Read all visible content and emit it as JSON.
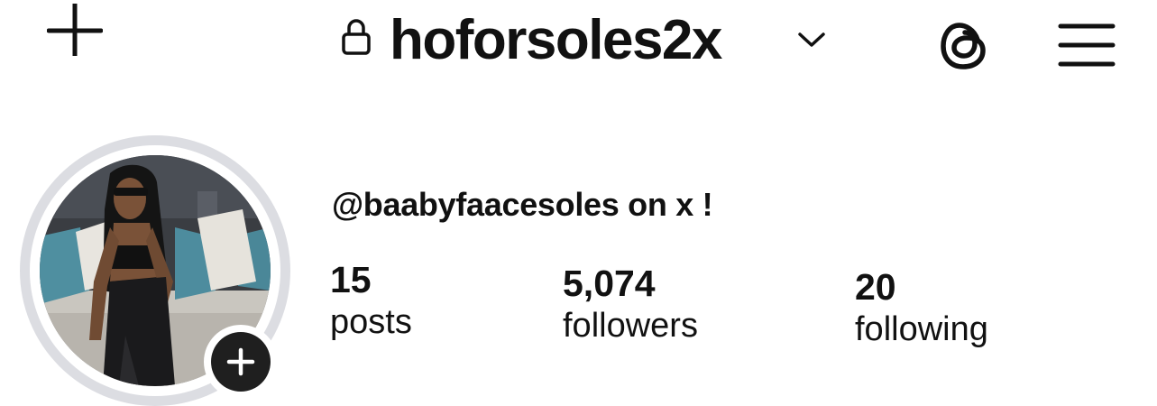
{
  "header": {
    "username": "hoforsoles2x",
    "icons": {
      "create": "plus-icon",
      "private": "lock-icon",
      "account_switch": "chevron-down-icon",
      "threads": "threads-icon",
      "menu": "hamburger-menu-icon"
    }
  },
  "profile": {
    "bio": "@baabyfaacesoles on x !",
    "avatar": {
      "add_story_icon": "plus-icon"
    },
    "stats": {
      "posts": {
        "value": "15",
        "label": "posts"
      },
      "followers": {
        "value": "5,074",
        "label": "followers"
      },
      "following": {
        "value": "20",
        "label": "following"
      }
    }
  },
  "colors": {
    "text": "#111111",
    "background": "#ffffff",
    "story_ring": "#dcdde2",
    "add_story_button": "#1f1f1f"
  }
}
